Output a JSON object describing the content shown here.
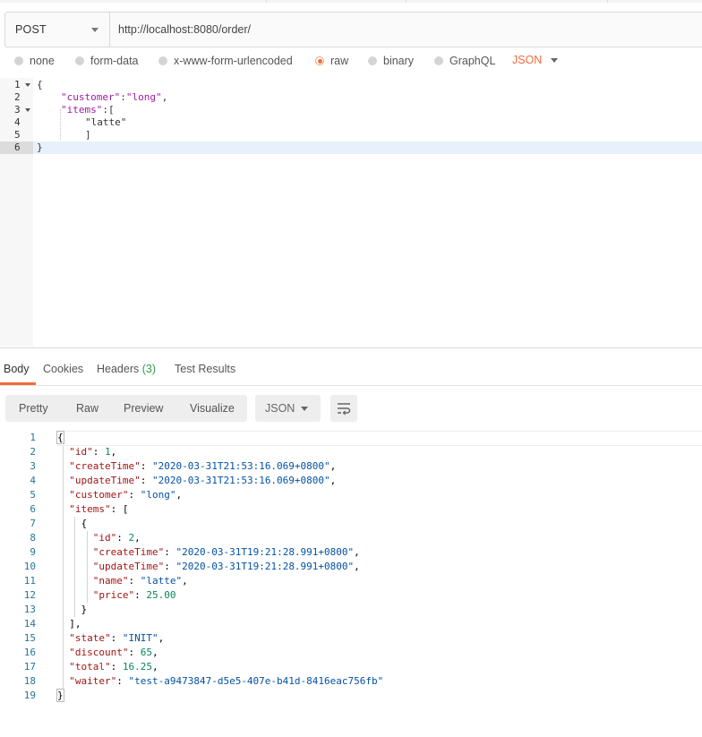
{
  "request": {
    "method": "POST",
    "url": "http://localhost:8080/order/"
  },
  "body_types": [
    {
      "label": "none",
      "selected": false
    },
    {
      "label": "form-data",
      "selected": false
    },
    {
      "label": "x-www-form-urlencoded",
      "selected": false
    },
    {
      "label": "raw",
      "selected": true
    },
    {
      "label": "binary",
      "selected": false
    },
    {
      "label": "GraphQL",
      "selected": false
    }
  ],
  "raw_format": "JSON",
  "request_body": {
    "line_numbers": [
      "1",
      "2",
      "3",
      "4",
      "5",
      "6"
    ],
    "lines": [
      {
        "text": "{"
      },
      {
        "key": "\"customer\"",
        "sep": ":",
        "value": "\"long\"",
        "tail": ","
      },
      {
        "key": "\"items\"",
        "sep": ":",
        "tail": "["
      },
      {
        "value": "\"latte\""
      },
      {
        "text": "]"
      },
      {
        "text": "}"
      }
    ]
  },
  "response_tabs": {
    "body": "Body",
    "cookies": "Cookies",
    "headers": "Headers",
    "headers_count": "(3)",
    "test_results": "Test Results"
  },
  "view_modes": [
    "Pretty",
    "Raw",
    "Preview",
    "Visualize"
  ],
  "response_format": "JSON",
  "response_body": {
    "line_numbers": [
      "1",
      "2",
      "3",
      "4",
      "5",
      "6",
      "7",
      "8",
      "9",
      "10",
      "11",
      "12",
      "13",
      "14",
      "15",
      "16",
      "17",
      "18",
      "19"
    ],
    "id": "1",
    "createTime": "\"2020-03-31T21:53:16.069+0800\"",
    "updateTime": "\"2020-03-31T21:53:16.069+0800\"",
    "customer": "\"long\"",
    "item": {
      "id": "2",
      "createTime": "\"2020-03-31T19:21:28.991+0800\"",
      "updateTime": "\"2020-03-31T19:21:28.991+0800\"",
      "name": "\"latte\"",
      "price": "25.00"
    },
    "state": "\"INIT\"",
    "discount": "65",
    "total": "16.25",
    "waiter": "\"test-a9473847-d5e5-407e-b41d-8416eac756fb\""
  },
  "colors": {
    "accent": "#f26b3a",
    "json_key": "#a31515",
    "json_string": "#0451a5",
    "json_number": "#098658",
    "request_string": "#a11ba1",
    "headers_count": "#2f9b4f"
  },
  "icons": [
    "dropdown-caret-icon",
    "wrap-lines-icon",
    "fold-arrow-icon"
  ]
}
